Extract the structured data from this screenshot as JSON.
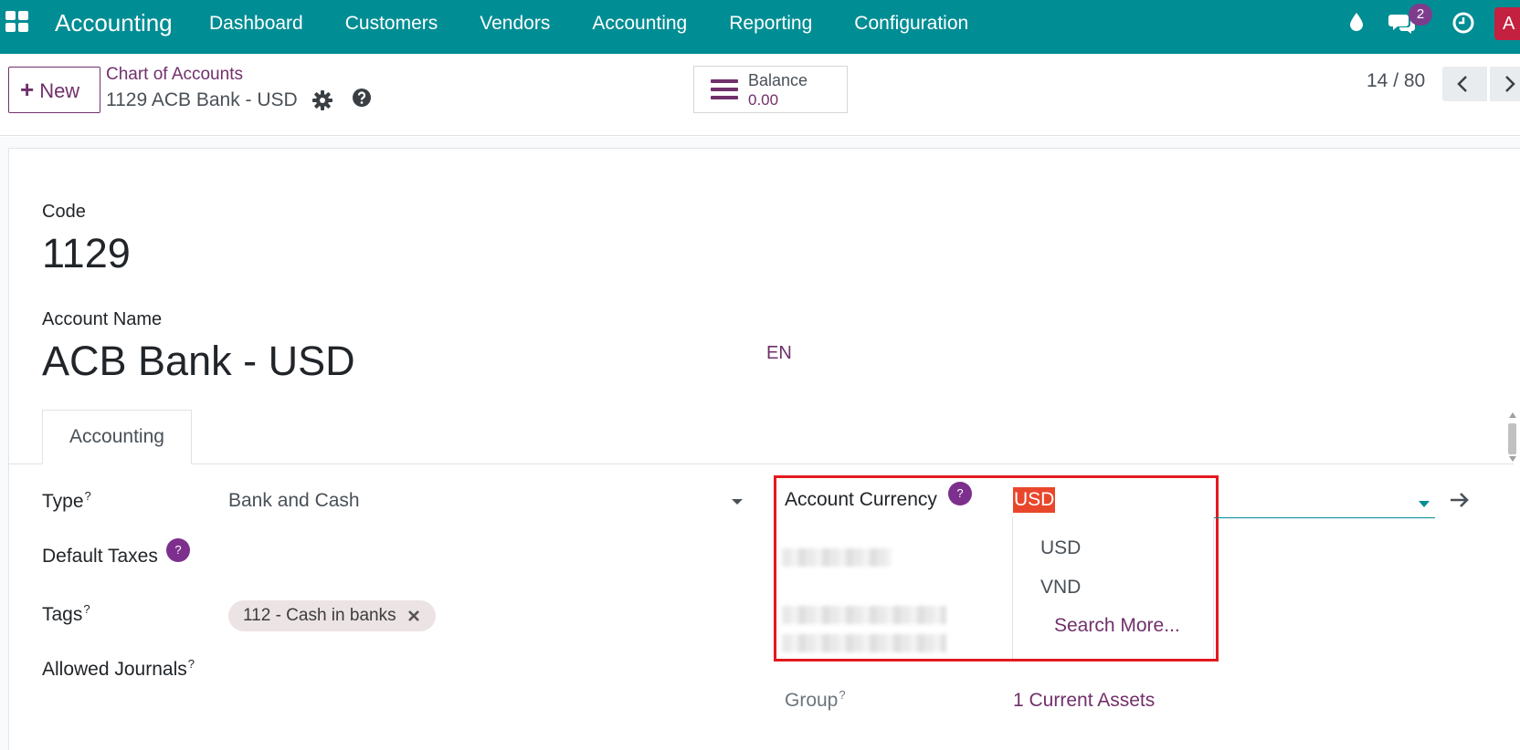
{
  "navbar": {
    "brand": "Accounting",
    "menu": [
      "Dashboard",
      "Customers",
      "Vendors",
      "Accounting",
      "Reporting",
      "Configuration"
    ],
    "chat_count": "2",
    "avatar_letter": "A",
    "bg_color": "#018d94"
  },
  "control": {
    "new_label": "New",
    "breadcrumb_parent": "Chart of Accounts",
    "breadcrumb_current": "1129 ACB Bank - USD",
    "balance_label": "Balance",
    "balance_value": "0.00",
    "pager": "14 / 80"
  },
  "form": {
    "code_label": "Code",
    "code_value": "1129",
    "name_label": "Account Name",
    "name_value": "ACB Bank - USD",
    "lang": "EN",
    "tab": "Accounting",
    "type_label": "Type",
    "type_value": "Bank and Cash",
    "default_taxes_label": "Default Taxes",
    "tags_label": "Tags",
    "tag_chip": "112 - Cash in banks",
    "allowed_journals_label": "Allowed Journals",
    "currency_label": "Account Currency",
    "currency_value": "USD",
    "currency_options": [
      "USD",
      "VND"
    ],
    "search_more": "Search More...",
    "group_label": "Group",
    "group_value": "1 Current Assets",
    "help_mark": "?",
    "sup_mark": "?"
  },
  "colors": {
    "accent": "#71306c",
    "badge": "#7d2f8d",
    "highlight": "#e3191e",
    "selection": "#e9472c"
  }
}
